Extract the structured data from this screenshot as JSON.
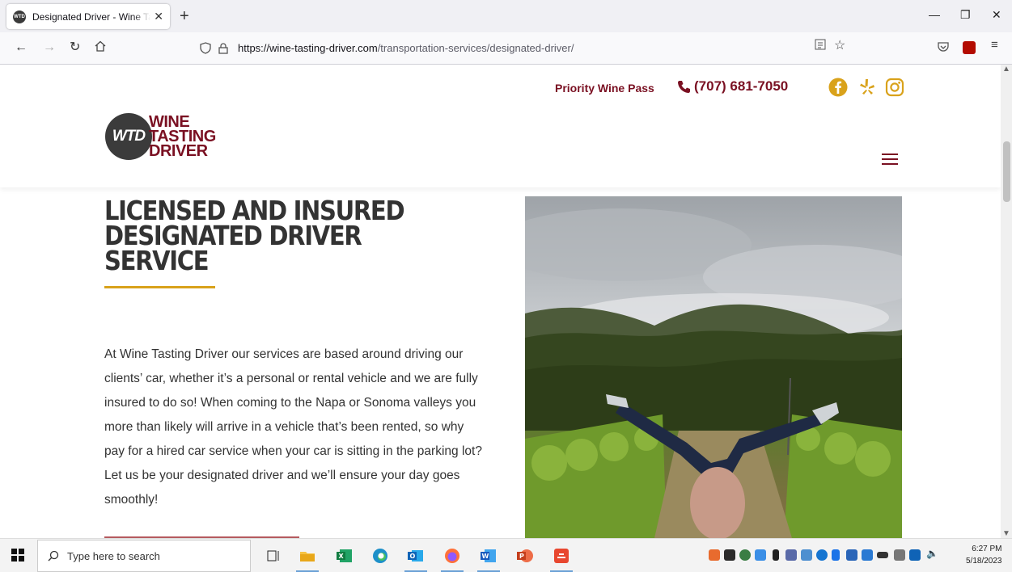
{
  "browser": {
    "tab_title": "Designated Driver - Wine Tasting Driver",
    "tab_favicon": "WTD",
    "url_domain": "https://wine-tasting-driver.com",
    "url_path": "/transportation-services/designated-driver/"
  },
  "header": {
    "priority_label": "Priority Wine Pass",
    "phone": "(707) 681-7050",
    "logo": {
      "badge": "WTD",
      "line1": "WINE",
      "line2": "TASTING",
      "line3": "DRIVER"
    },
    "brand_color": "#7a1022",
    "social_icons": [
      "facebook-icon",
      "yelp-icon",
      "instagram-icon"
    ]
  },
  "main": {
    "headline_line1": "LICENSED AND INSURED",
    "headline_line2": "DESIGNATED DRIVER SERVICE",
    "accent_color": "#d9a21b",
    "body": "At Wine Tasting Driver our services are based around driving our clients’ car, whether it’s a personal or rental vehicle and we are fully insured to do so! When coming to the Napa or Sonoma valleys you more than likely will arrive in a vehicle that’s been rented, so why pay for a hired car service when your car is sitting in the parking lot? Let us be your designated driver and we’ll ensure your day goes smoothly!"
  },
  "taskbar": {
    "search_placeholder": "Type here to search",
    "time": "6:27 PM",
    "date": "5/18/2023"
  }
}
